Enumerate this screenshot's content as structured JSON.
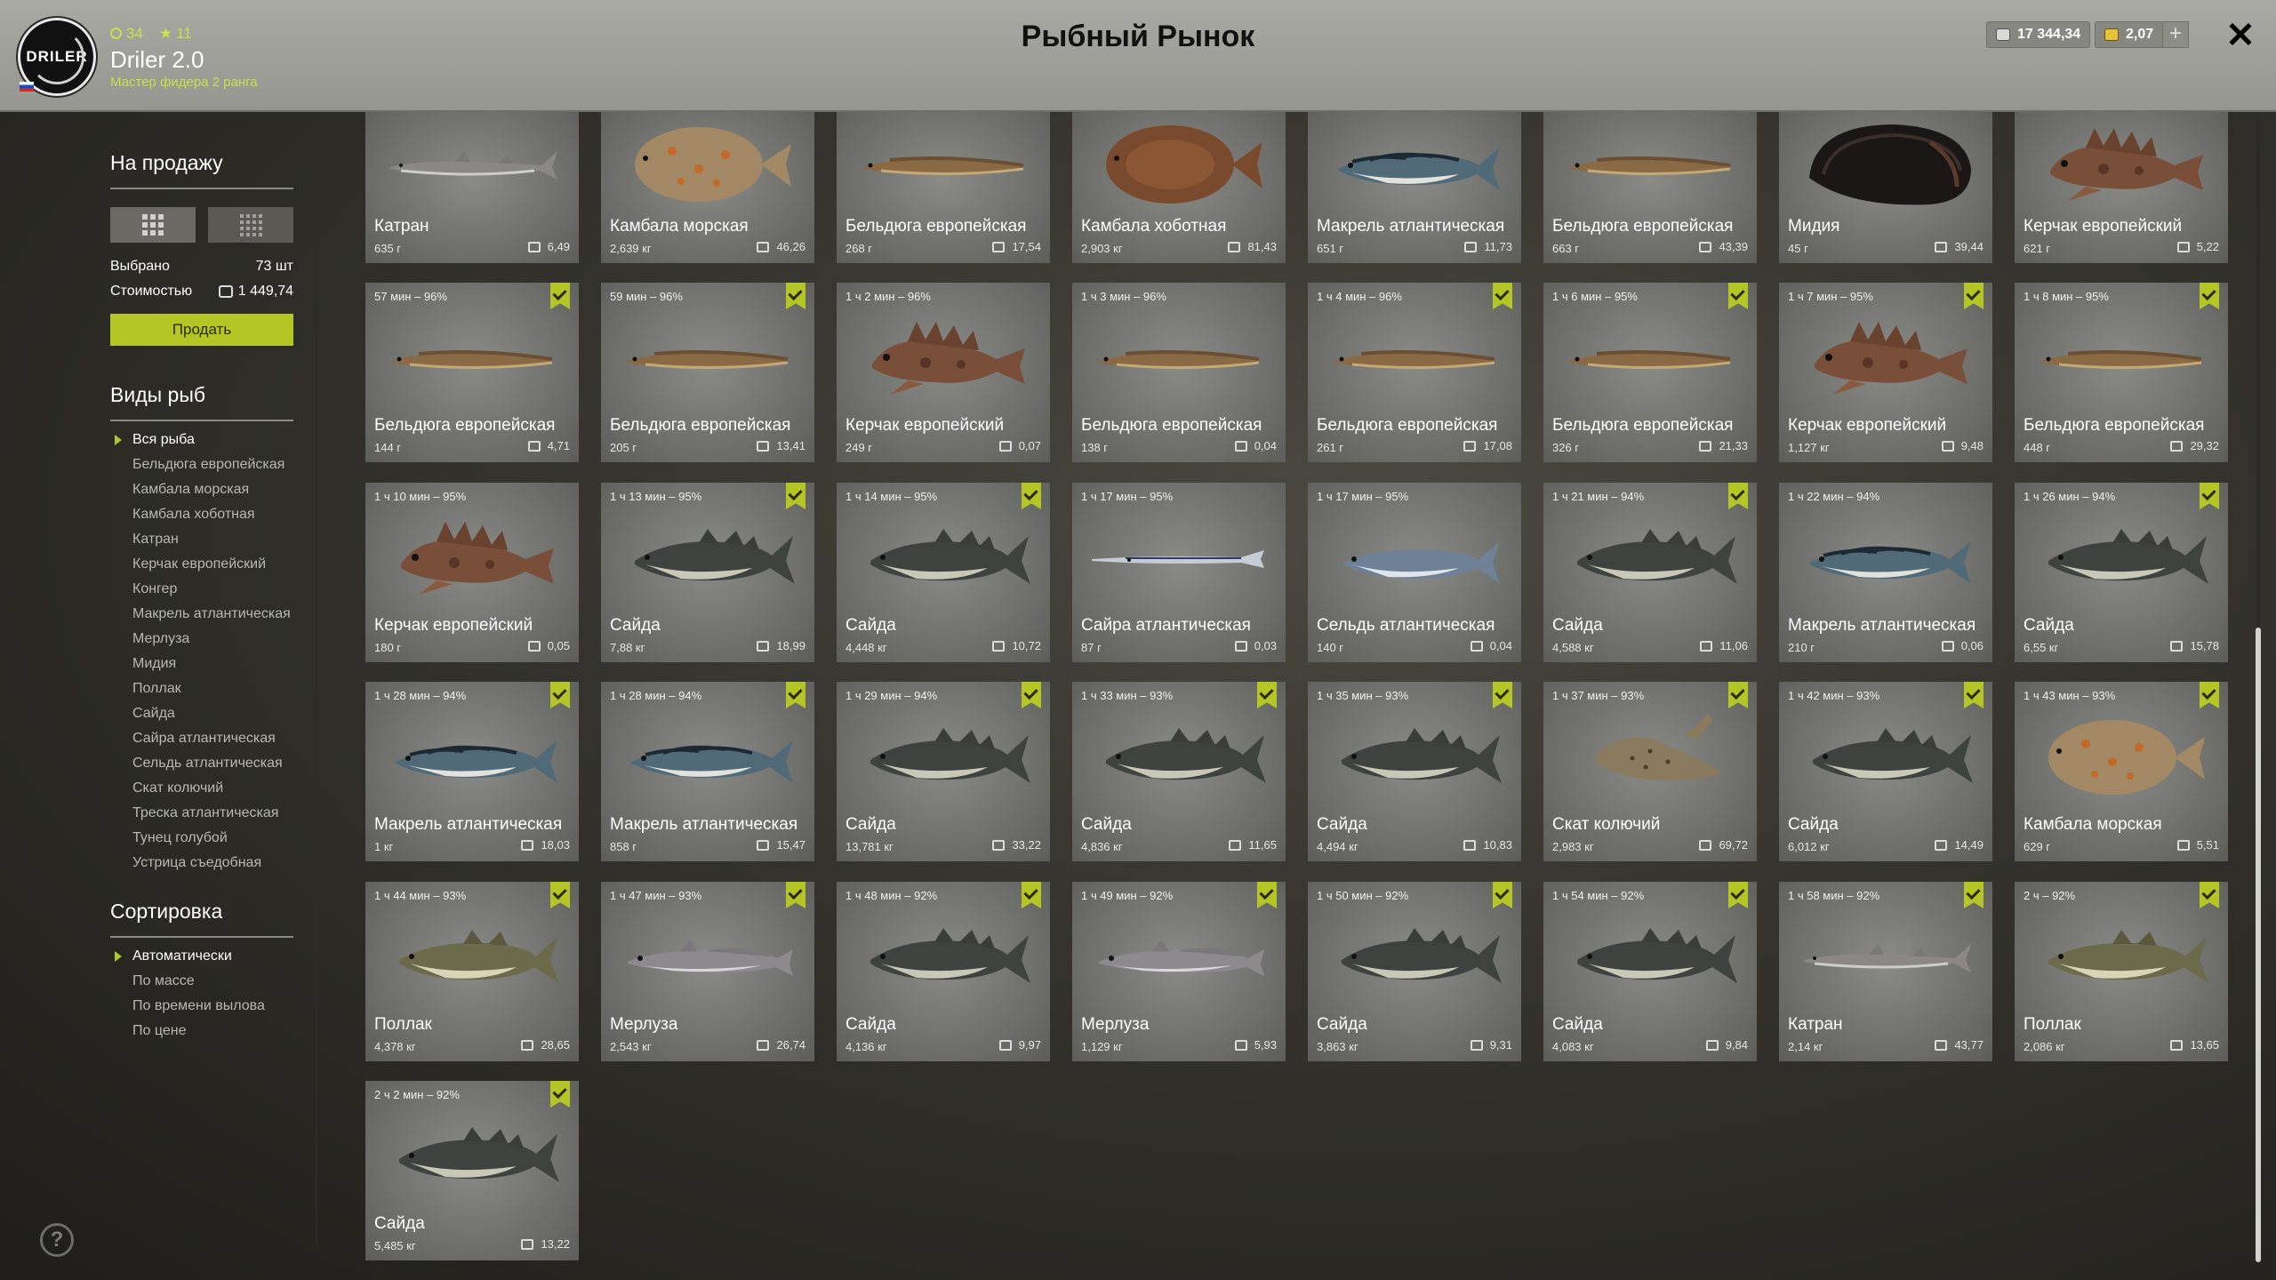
{
  "header": {
    "title": "Рыбный Рынок",
    "player_name": "Driler 2.0",
    "player_rank": "Мастер фидера 2 ранга",
    "stat_coins": "34",
    "stat_stars": "11",
    "avatar_text": "DRILER",
    "silver_balance": "17 344,34",
    "gold_balance": "2,07",
    "plus_label": "+",
    "close_label": "✕"
  },
  "sidebar": {
    "for_sale_title": "На продажу",
    "selected_label": "Выбрано",
    "selected_value": "73 шт",
    "cost_label": "Стоимостью",
    "cost_value": "1 449,74",
    "sell_button": "Продать",
    "species_title": "Виды рыб",
    "species": [
      "Вся рыба",
      "Бельдюга европейская",
      "Камбала морская",
      "Камбала хоботная",
      "Катран",
      "Керчак европейский",
      "Конгер",
      "Макрель атлантическая",
      "Мерлуза",
      "Мидия",
      "Поллак",
      "Сайда",
      "Сайра атлантическая",
      "Сельдь атлантическая",
      "Скат колючий",
      "Треска атлантическая",
      "Тунец голубой",
      "Устрица съедобная"
    ],
    "selected_species": "Вся рыба",
    "sort_title": "Сортировка",
    "sort_options": [
      "Автоматически",
      "По массе",
      "По времени вылова",
      "По цене"
    ],
    "selected_sort": "Автоматически",
    "help_label": "?"
  },
  "colors": {
    "accent": "#b4c625",
    "header_bg": "#a0a09a",
    "card_bg": "#7a7a77"
  },
  "cards": [
    {
      "name": "Катран",
      "weight": "635 г",
      "price": "6,49",
      "time": "",
      "checked": false,
      "fish": "shark"
    },
    {
      "name": "Камбала морская",
      "weight": "2,639 кг",
      "price": "46,26",
      "time": "",
      "checked": false,
      "fish": "flounder"
    },
    {
      "name": "Бельдюга европейская",
      "weight": "268 г",
      "price": "17,54",
      "time": "",
      "checked": false,
      "fish": "eelpout"
    },
    {
      "name": "Камбала хоботная",
      "weight": "2,903 кг",
      "price": "81,43",
      "time": "",
      "checked": false,
      "fish": "flounder-brown"
    },
    {
      "name": "Макрель атлантическая",
      "weight": "651 г",
      "price": "11,73",
      "time": "",
      "checked": false,
      "fish": "mackerel"
    },
    {
      "name": "Бельдюга европейская",
      "weight": "663 г",
      "price": "43,39",
      "time": "",
      "checked": false,
      "fish": "eelpout"
    },
    {
      "name": "Мидия",
      "weight": "45 г",
      "price": "39,44",
      "time": "",
      "checked": false,
      "fish": "mussel"
    },
    {
      "name": "Керчак европейский",
      "weight": "621 г",
      "price": "5,22",
      "time": "",
      "checked": false,
      "fish": "sculpin"
    },
    {
      "name": "Бельдюга европейская",
      "weight": "144 г",
      "price": "4,71",
      "time": "57 мин – 96%",
      "checked": true,
      "fish": "eelpout"
    },
    {
      "name": "Бельдюга европейская",
      "weight": "205 г",
      "price": "13,41",
      "time": "59 мин – 96%",
      "checked": true,
      "fish": "eelpout"
    },
    {
      "name": "Керчак европейский",
      "weight": "249 г",
      "price": "0,07",
      "time": "1 ч 2 мин – 96%",
      "checked": false,
      "fish": "sculpin"
    },
    {
      "name": "Бельдюга европейская",
      "weight": "138 г",
      "price": "0,04",
      "time": "1 ч 3 мин – 96%",
      "checked": false,
      "fish": "eelpout"
    },
    {
      "name": "Бельдюга европейская",
      "weight": "261 г",
      "price": "17,08",
      "time": "1 ч 4 мин – 96%",
      "checked": true,
      "fish": "eelpout"
    },
    {
      "name": "Бельдюга европейская",
      "weight": "326 г",
      "price": "21,33",
      "time": "1 ч 6 мин – 95%",
      "checked": true,
      "fish": "eelpout"
    },
    {
      "name": "Керчак европейский",
      "weight": "1,127 кг",
      "price": "9,48",
      "time": "1 ч 7 мин – 95%",
      "checked": true,
      "fish": "sculpin"
    },
    {
      "name": "Бельдюга европейская",
      "weight": "448 г",
      "price": "29,32",
      "time": "1 ч 8 мин – 95%",
      "checked": true,
      "fish": "eelpout"
    },
    {
      "name": "Керчак европейский",
      "weight": "180 г",
      "price": "0,05",
      "time": "1 ч 10 мин – 95%",
      "checked": false,
      "fish": "sculpin"
    },
    {
      "name": "Сайда",
      "weight": "7,88 кг",
      "price": "18,99",
      "time": "1 ч 13 мин – 95%",
      "checked": true,
      "fish": "saithe"
    },
    {
      "name": "Сайда",
      "weight": "4,448 кг",
      "price": "10,72",
      "time": "1 ч 14 мин – 95%",
      "checked": true,
      "fish": "saithe"
    },
    {
      "name": "Сайра атлантическая",
      "weight": "87 г",
      "price": "0,03",
      "time": "1 ч 17 мин – 95%",
      "checked": false,
      "fish": "saury"
    },
    {
      "name": "Сельдь атлантическая",
      "weight": "140 г",
      "price": "0,04",
      "time": "1 ч 17 мин – 95%",
      "checked": false,
      "fish": "herring"
    },
    {
      "name": "Сайда",
      "weight": "4,588 кг",
      "price": "11,06",
      "time": "1 ч 21 мин – 94%",
      "checked": true,
      "fish": "saithe"
    },
    {
      "name": "Макрель атлантическая",
      "weight": "210 г",
      "price": "0,06",
      "time": "1 ч 22 мин – 94%",
      "checked": false,
      "fish": "mackerel"
    },
    {
      "name": "Сайда",
      "weight": "6,55 кг",
      "price": "15,78",
      "time": "1 ч 26 мин – 94%",
      "checked": true,
      "fish": "saithe"
    },
    {
      "name": "Макрель атлантическая",
      "weight": "1 кг",
      "price": "18,03",
      "time": "1 ч 28 мин – 94%",
      "checked": true,
      "fish": "mackerel"
    },
    {
      "name": "Макрель атлантическая",
      "weight": "858 г",
      "price": "15,47",
      "time": "1 ч 28 мин – 94%",
      "checked": true,
      "fish": "mackerel"
    },
    {
      "name": "Сайда",
      "weight": "13,781 кг",
      "price": "33,22",
      "time": "1 ч 29 мин – 94%",
      "checked": true,
      "fish": "saithe"
    },
    {
      "name": "Сайда",
      "weight": "4,836 кг",
      "price": "11,65",
      "time": "1 ч 33 мин – 93%",
      "checked": true,
      "fish": "saithe"
    },
    {
      "name": "Сайда",
      "weight": "4,494 кг",
      "price": "10,83",
      "time": "1 ч 35 мин – 93%",
      "checked": true,
      "fish": "saithe"
    },
    {
      "name": "Скат колючий",
      "weight": "2,983 кг",
      "price": "69,72",
      "time": "1 ч 37 мин – 93%",
      "checked": true,
      "fish": "ray"
    },
    {
      "name": "Сайда",
      "weight": "6,012 кг",
      "price": "14,49",
      "time": "1 ч 42 мин – 93%",
      "checked": true,
      "fish": "saithe"
    },
    {
      "name": "Камбала морская",
      "weight": "629 г",
      "price": "5,51",
      "time": "1 ч 43 мин – 93%",
      "checked": true,
      "fish": "flounder"
    },
    {
      "name": "Поллак",
      "weight": "4,378 кг",
      "price": "28,65",
      "time": "1 ч 44 мин – 93%",
      "checked": true,
      "fish": "pollack"
    },
    {
      "name": "Мерлуза",
      "weight": "2,543 кг",
      "price": "26,74",
      "time": "1 ч 47 мин – 93%",
      "checked": true,
      "fish": "hake"
    },
    {
      "name": "Сайда",
      "weight": "4,136 кг",
      "price": "9,97",
      "time": "1 ч 48 мин – 92%",
      "checked": true,
      "fish": "saithe"
    },
    {
      "name": "Мерлуза",
      "weight": "1,129 кг",
      "price": "5,93",
      "time": "1 ч 49 мин – 92%",
      "checked": true,
      "fish": "hake"
    },
    {
      "name": "Сайда",
      "weight": "3,863 кг",
      "price": "9,31",
      "time": "1 ч 50 мин – 92%",
      "checked": true,
      "fish": "saithe"
    },
    {
      "name": "Сайда",
      "weight": "4,083 кг",
      "price": "9,84",
      "time": "1 ч 54 мин – 92%",
      "checked": true,
      "fish": "saithe"
    },
    {
      "name": "Катран",
      "weight": "2,14 кг",
      "price": "43,77",
      "time": "1 ч 58 мин – 92%",
      "checked": true,
      "fish": "shark"
    },
    {
      "name": "Поллак",
      "weight": "2,086 кг",
      "price": "13,65",
      "time": "2 ч – 92%",
      "checked": true,
      "fish": "pollack"
    },
    {
      "name": "Сайда",
      "weight": "5,485 кг",
      "price": "13,22",
      "time": "2 ч 2 мин – 92%",
      "checked": true,
      "fish": "saithe"
    }
  ]
}
